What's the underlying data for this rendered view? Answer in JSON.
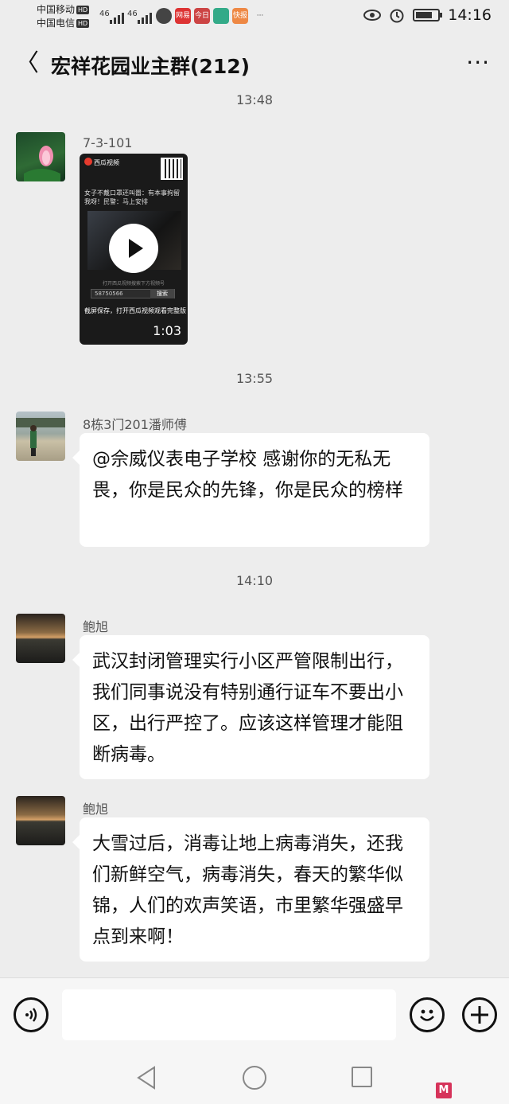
{
  "status_bar": {
    "carrier_1": "中国移动",
    "carrier_2": "中国电信",
    "hd": "HD",
    "net_1": "46",
    "net_2": "46",
    "app_labels": [
      "网易",
      "今日",
      "",
      "快报"
    ],
    "more": "···",
    "time": "14:16",
    "icons": [
      "eye-icon",
      "alarm-icon",
      "battery-icon"
    ]
  },
  "header": {
    "back": "〈",
    "title": "宏祥花园业主群(212)",
    "more": "···"
  },
  "messages": [
    {
      "time": "13:48",
      "sender": "7-3-101",
      "type": "video",
      "video": {
        "brand": "西瓜视频",
        "caption": "女子不戴口罩还叫嚣：有本事拘留我呀！民警：马上安排",
        "hint": "打开西瓜视频搜索下方视频号",
        "search_code": "58750566",
        "search_button": "搜索",
        "bottom": "截屏保存，打开西瓜视频观看完整版",
        "duration": "1:03"
      }
    },
    {
      "time": "13:55",
      "sender": "8栋3门201潘师傅",
      "type": "text",
      "text": "@佘威仪表电子学校  感谢你的无私无畏，你是民众的先锋，你是民众的榜样"
    },
    {
      "time": "14:10",
      "sender": "鲍旭",
      "type": "text",
      "text": "武汉封闭管理实行小区严管限制出行，我们同事说没有特别通行证车不要出小区，出行严控了。应该这样管理才能阻断病毒。"
    },
    {
      "sender": "鲍旭",
      "type": "text",
      "text": "大雪过后，消毒让地上病毒消失，还我们新鲜空气，病毒消失，春天的繁华似锦，人们的欢声笑语，市里繁华强盛早点到来啊！"
    }
  ],
  "input_bar": {
    "voice_icon": "voice-icon",
    "emoji_icon": "emoji-icon",
    "plus_icon": "plus-icon",
    "placeholder": ""
  },
  "watermark": "M"
}
